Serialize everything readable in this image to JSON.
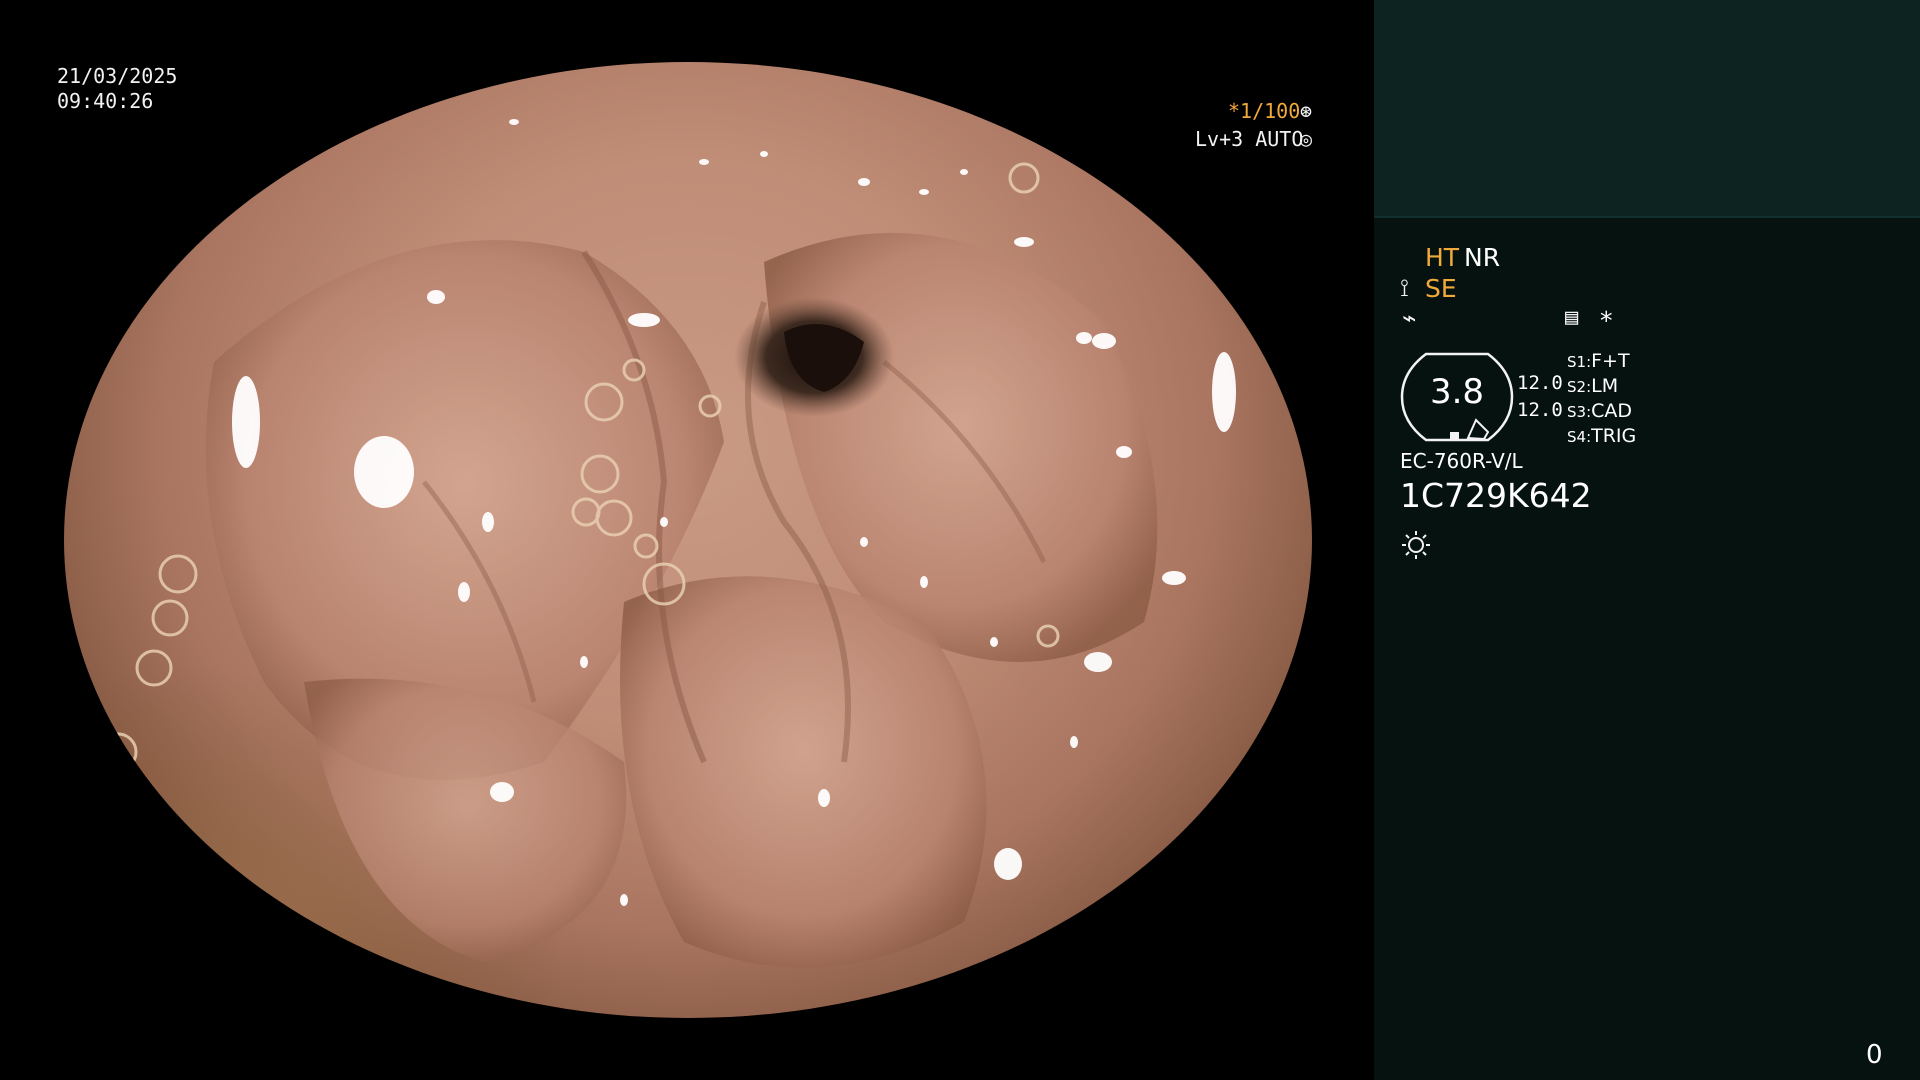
{
  "overlay": {
    "date": "21/03/2025",
    "time": "09:40:26",
    "shutter": "*1/100",
    "level": "Lv+3 AUTO"
  },
  "panel": {
    "mode_ht": "HT",
    "mode_nr": "NR",
    "mode_se": "SE",
    "star": "*",
    "gauge_value": "3.8",
    "value_top": "12.0",
    "value_bottom": "12.0",
    "switches": [
      {
        "key": "S1:",
        "value": "F+T"
      },
      {
        "key": "S2:",
        "value": "LM"
      },
      {
        "key": "S3:",
        "value": "CAD"
      },
      {
        "key": "S4:",
        "value": "TRIG"
      }
    ],
    "scope_model": "EC-760R-V/L",
    "serial": "1C729K642",
    "counter": "0"
  },
  "colors": {
    "accent_orange": "#f2a93b",
    "panel_bg": "#06120f",
    "panel_top": "#0d2322"
  },
  "icons": [
    "shutter-icon",
    "auto-iris-icon",
    "scope-tip-icon",
    "lightning-icon",
    "menu-icon",
    "brightness-icon"
  ]
}
